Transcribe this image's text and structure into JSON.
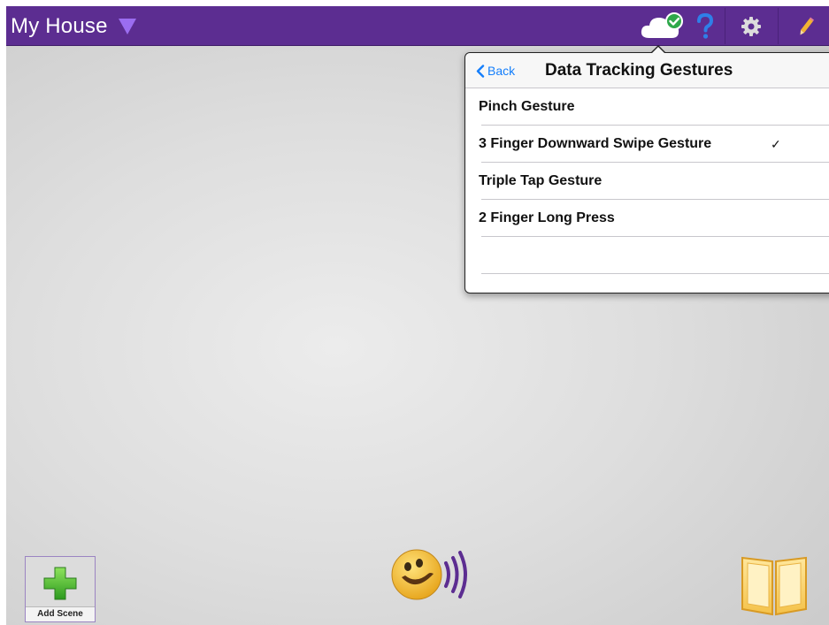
{
  "topbar": {
    "title": "My House",
    "icons": [
      "dropdown-triangle-icon",
      "cloud-sync-icon",
      "help-icon",
      "gear-icon",
      "pencil-icon"
    ],
    "background": "#5c2d91"
  },
  "popover": {
    "back_label": "Back",
    "title": "Data Tracking Gestures",
    "items": [
      {
        "label": "Pinch Gesture",
        "check": ""
      },
      {
        "label": "3 Finger Downward Swipe Gesture",
        "check": "✓"
      },
      {
        "label": "Triple Tap Gesture",
        "check": ""
      },
      {
        "label": "2 Finger Long Press",
        "check": ""
      },
      {
        "label": "",
        "check": ""
      }
    ]
  },
  "bottombar": {
    "add_scene_label": "Add Scene",
    "icons": [
      "add-plus-icon",
      "speaking-smiley-icon",
      "book-icon"
    ]
  },
  "colors": {
    "accent": "#147efb",
    "brand_purple": "#5c2d91",
    "help_blue": "#2f7fe8",
    "sync_green": "#2ea84a"
  }
}
